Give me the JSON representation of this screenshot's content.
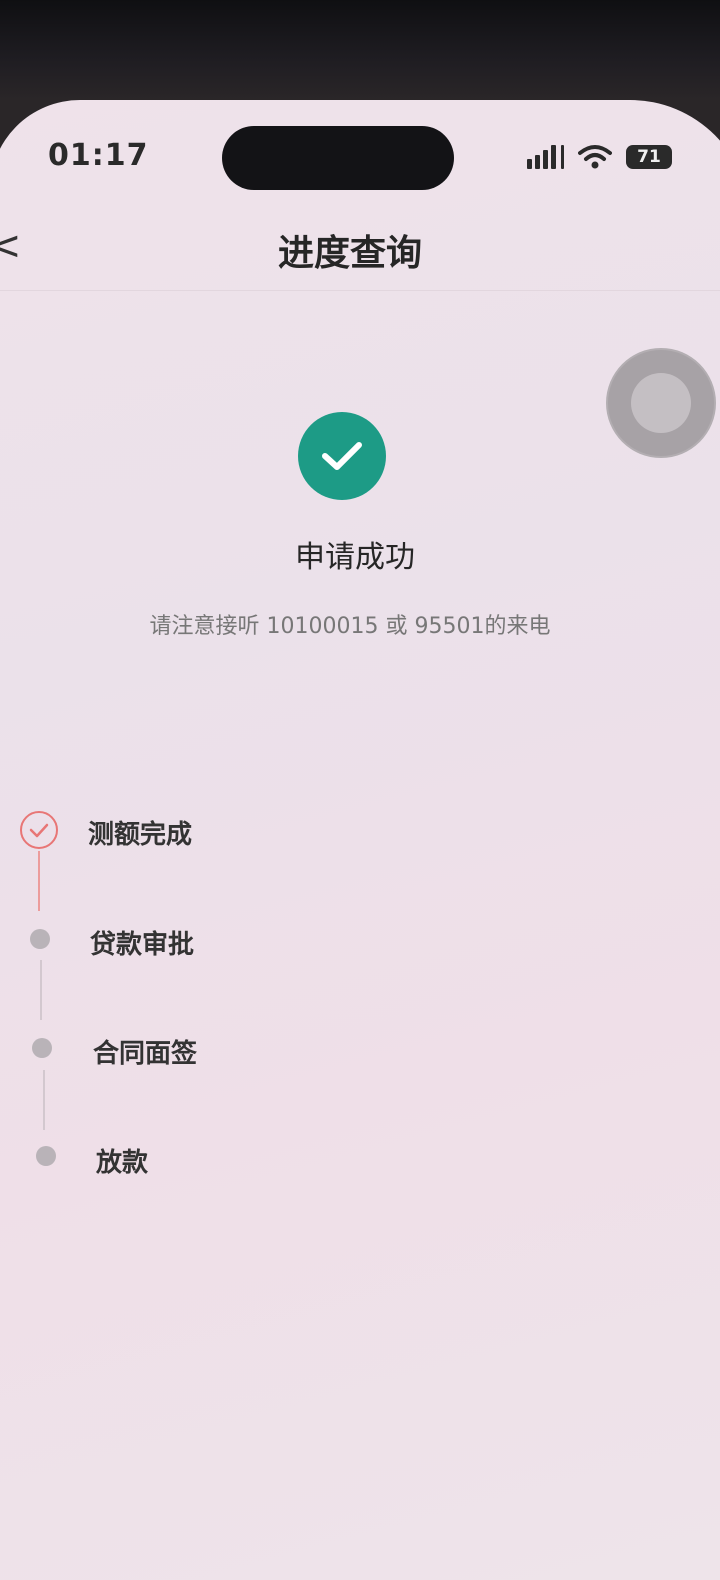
{
  "status_bar": {
    "time": "01:17",
    "battery": "71"
  },
  "nav": {
    "back_glyph": "<",
    "title": "进度查询"
  },
  "result": {
    "icon": "checkmark-circle-icon",
    "title": "申请成功",
    "note": "请注意接听 10100015 或 95501的来电",
    "accent_color": "#1d9b86"
  },
  "timeline": {
    "steps": [
      {
        "label": "测额完成",
        "status": "done"
      },
      {
        "label": "贷款审批",
        "status": "pending"
      },
      {
        "label": "合同面签",
        "status": "pending"
      },
      {
        "label": "放款",
        "status": "pending"
      }
    ],
    "done_color": "#e87676"
  }
}
